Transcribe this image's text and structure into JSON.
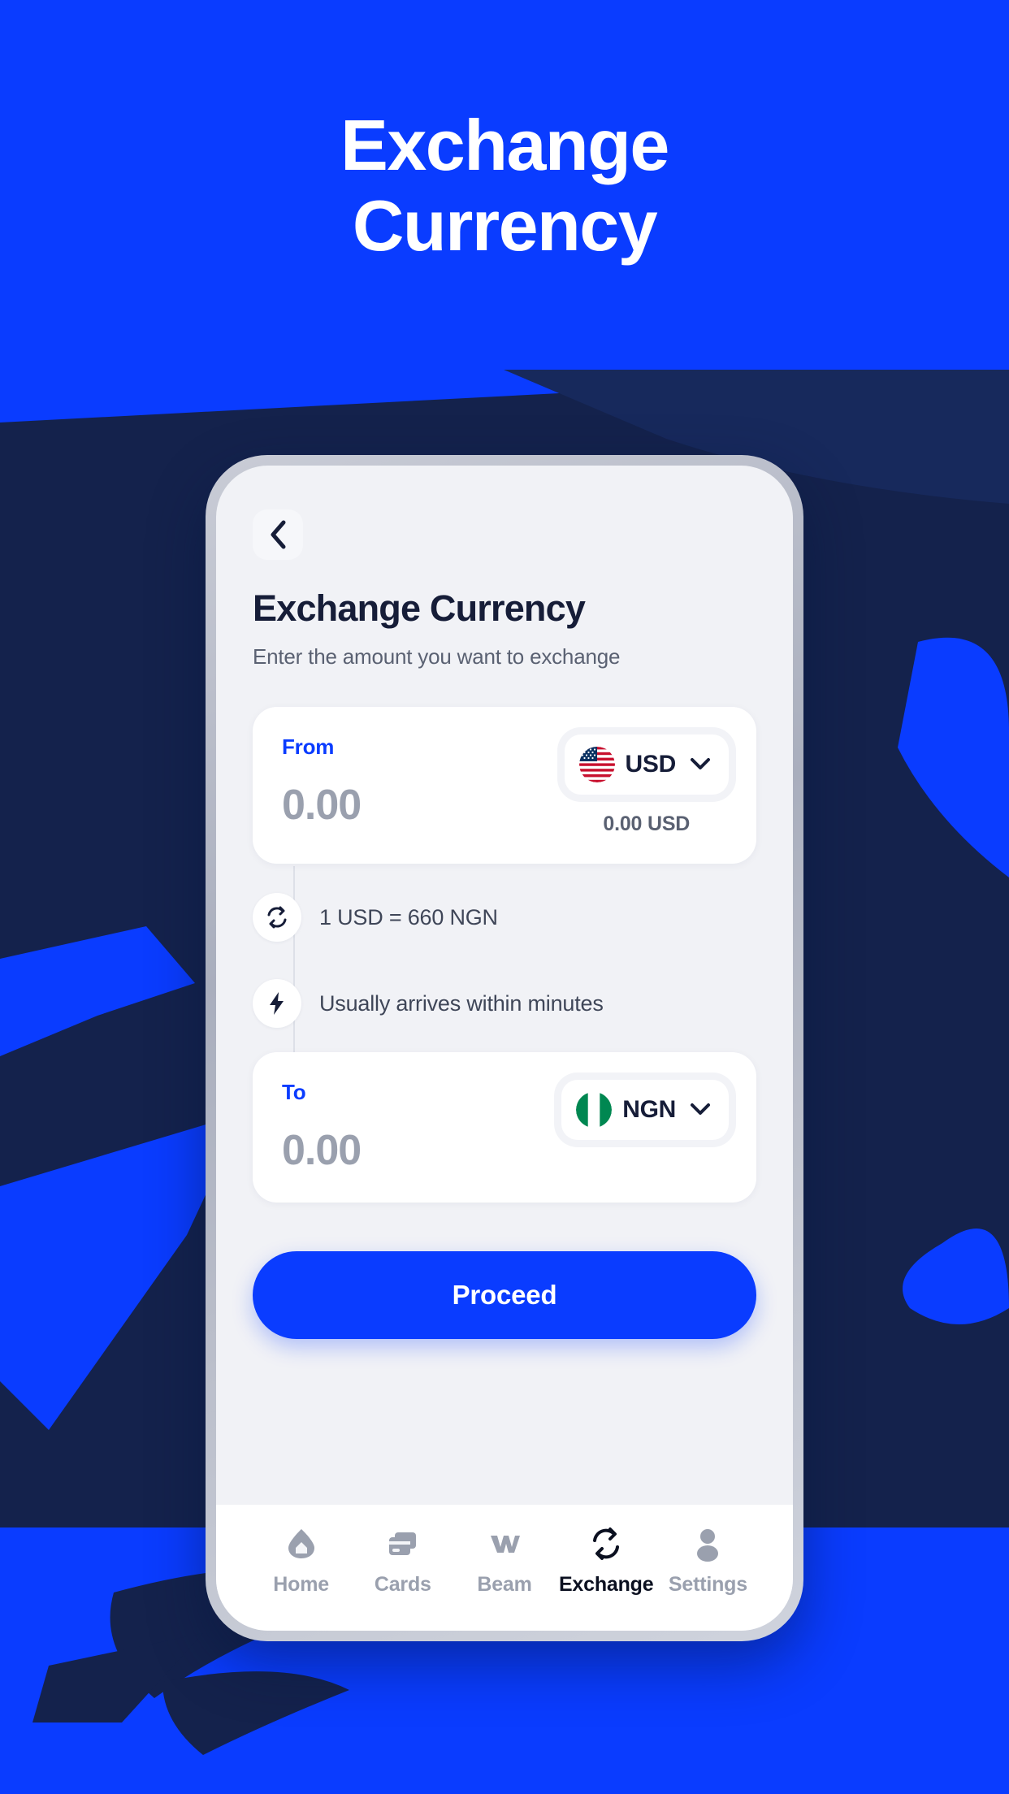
{
  "hero": {
    "line1": "Exchange",
    "line2": "Currency"
  },
  "theme": {
    "brand_blue": "#0A3CFF",
    "dark_navy": "#14224C",
    "screen_bg": "#F1F2F6",
    "card_bg": "#FFFFFF",
    "muted_text": "#5A6172",
    "amount_gray": "#9AA0AE",
    "title_navy": "#161D38"
  },
  "app": {
    "back_icon": "chevron-left-icon",
    "title": "Exchange Currency",
    "subtitle": "Enter the amount you want to exchange",
    "from": {
      "label": "From",
      "amount": "0.00",
      "currency_code": "USD",
      "flag": "us-flag-icon",
      "chevron": "chevron-down-icon",
      "converted": "0.00 USD"
    },
    "to": {
      "label": "To",
      "amount": "0.00",
      "currency_code": "NGN",
      "flag": "ng-flag-icon",
      "chevron": "chevron-down-icon"
    },
    "info": [
      {
        "icon": "exchange-rate-icon",
        "text": "1 USD = 660 NGN"
      },
      {
        "icon": "lightning-bolt-icon",
        "text": "Usually arrives within minutes"
      }
    ],
    "proceed_label": "Proceed",
    "tabs": [
      {
        "label": "Home",
        "icon": "home-icon",
        "active": false
      },
      {
        "label": "Cards",
        "icon": "card-icon",
        "active": false
      },
      {
        "label": "Beam",
        "icon": "beam-icon",
        "active": false
      },
      {
        "label": "Exchange",
        "icon": "exchange-icon",
        "active": true
      },
      {
        "label": "Settings",
        "icon": "person-icon",
        "active": false
      }
    ]
  }
}
